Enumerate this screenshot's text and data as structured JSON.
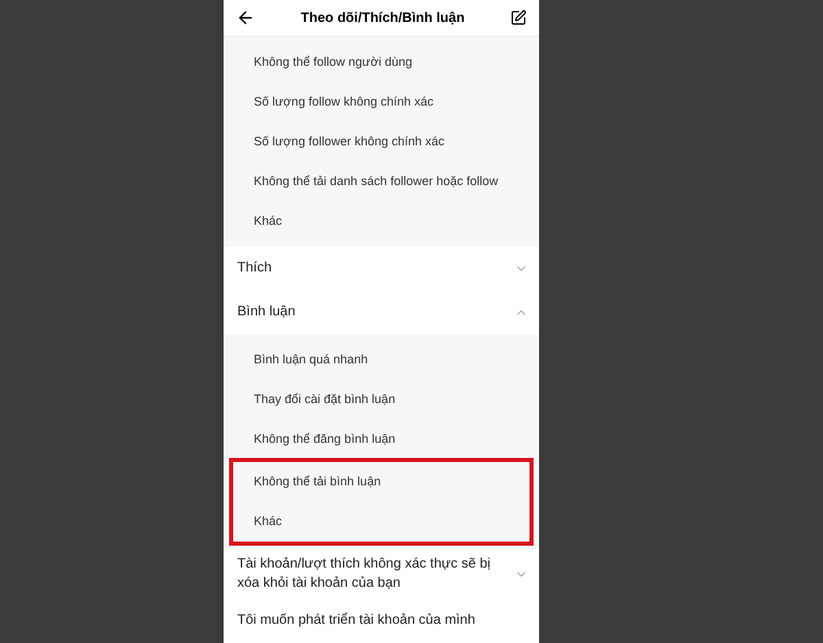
{
  "header": {
    "title": "Theo dõi/Thích/Bình luận"
  },
  "top_items": [
    {
      "label": "Không thể follow người dùng",
      "highlighted": false
    },
    {
      "label": "Số lượng follow không chính xác",
      "highlighted": false
    },
    {
      "label": "Số lượng follower không chính xác",
      "highlighted": false
    },
    {
      "label": "Không thể tải danh sách follower hoặc follow",
      "highlighted": false
    },
    {
      "label": "Khác",
      "highlighted": false
    }
  ],
  "sections": [
    {
      "label": "Thích",
      "expanded": false,
      "kind": "expandable"
    },
    {
      "label": "Bình luận",
      "expanded": true,
      "kind": "expandable",
      "children": [
        {
          "label": "Bình luận quá nhanh",
          "highlighted": false
        },
        {
          "label": "Thay đổi cài đặt bình luận",
          "highlighted": false
        },
        {
          "label": "Không thể đăng bình luận",
          "highlighted": false
        },
        {
          "label": "Không thể tải bình luận",
          "highlighted": true
        },
        {
          "label": "Khác",
          "highlighted": true
        }
      ]
    },
    {
      "label": "Tài khoản/lượt thích không xác thực sẽ bị xóa khỏi tài khoản của bạn",
      "expanded": false,
      "kind": "expandable"
    },
    {
      "label": "Tôi muốn phát triển tài khoản của mình",
      "kind": "link"
    }
  ]
}
